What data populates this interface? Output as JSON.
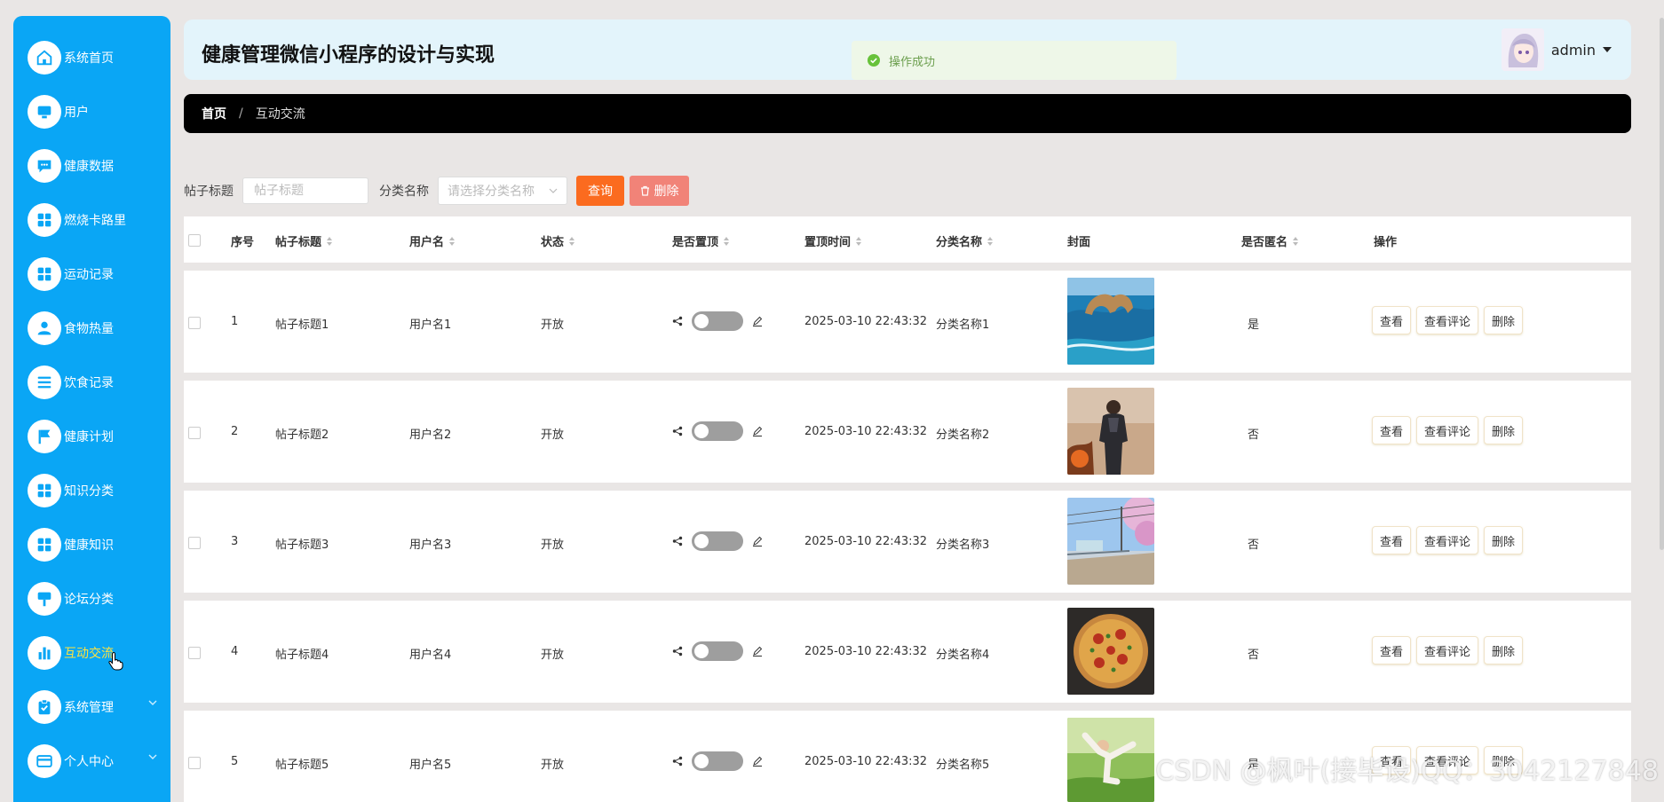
{
  "app_title": "健康管理微信小程序的设计与实现",
  "toast": "操作成功",
  "user": {
    "name": "admin"
  },
  "breadcrumb": {
    "home": "首页",
    "separator": "/",
    "current": "互动交流"
  },
  "sidebar": {
    "items": [
      {
        "label": "系统首页",
        "icon": "home-icon"
      },
      {
        "label": "用户",
        "icon": "monitor-icon"
      },
      {
        "label": "健康数据",
        "icon": "chat-icon"
      },
      {
        "label": "燃烧卡路里",
        "icon": "grid-icon"
      },
      {
        "label": "运动记录",
        "icon": "grid-icon"
      },
      {
        "label": "食物热量",
        "icon": "user-icon"
      },
      {
        "label": "饮食记录",
        "icon": "list-icon"
      },
      {
        "label": "健康计划",
        "icon": "flag-icon"
      },
      {
        "label": "知识分类",
        "icon": "grid-icon"
      },
      {
        "label": "健康知识",
        "icon": "grid-icon"
      },
      {
        "label": "论坛分类",
        "icon": "signpost-icon"
      },
      {
        "label": "互动交流",
        "icon": "bar-chart-icon",
        "active": true
      },
      {
        "label": "系统管理",
        "icon": "clipboard-icon",
        "expandable": true
      },
      {
        "label": "个人中心",
        "icon": "card-icon",
        "expandable": true
      }
    ]
  },
  "search": {
    "title_label": "帖子标题",
    "title_placeholder": "帖子标题",
    "category_label": "分类名称",
    "category_placeholder": "请选择分类名称",
    "query_button": "查询",
    "delete_button": "删除"
  },
  "table": {
    "headers": {
      "index": "序号",
      "title": "帖子标题",
      "username": "用户名",
      "status": "状态",
      "pinned": "是否置顶",
      "pin_time": "置顶时间",
      "category": "分类名称",
      "cover": "封面",
      "anonymous": "是否匿名",
      "actions": "操作"
    },
    "rows": [
      {
        "index": "1",
        "title": "帖子标题1",
        "username": "用户名1",
        "status": "开放",
        "pinned": false,
        "pin_time": "2025-03-10 22:43:32",
        "category": "分类名称1",
        "cover": "sea-arch-photo",
        "anonymous": "是"
      },
      {
        "index": "2",
        "title": "帖子标题2",
        "username": "用户名2",
        "status": "开放",
        "pinned": false,
        "pin_time": "2025-03-10 22:43:32",
        "category": "分类名称2",
        "cover": "hero-figure-photo",
        "anonymous": "否"
      },
      {
        "index": "3",
        "title": "帖子标题3",
        "username": "用户名3",
        "status": "开放",
        "pinned": false,
        "pin_time": "2025-03-10 22:43:32",
        "category": "分类名称3",
        "cover": "anime-street-photo",
        "anonymous": "否"
      },
      {
        "index": "4",
        "title": "帖子标题4",
        "username": "用户名4",
        "status": "开放",
        "pinned": false,
        "pin_time": "2025-03-10 22:43:32",
        "category": "分类名称4",
        "cover": "pizza-photo",
        "anonymous": "否"
      },
      {
        "index": "5",
        "title": "帖子标题5",
        "username": "用户名5",
        "status": "开放",
        "pinned": false,
        "pin_time": "2025-03-10 22:43:32",
        "category": "分类名称5",
        "cover": "yoga-photo",
        "anonymous": "是"
      }
    ],
    "row_actions": {
      "view": "查看",
      "view_comments": "查看评论",
      "delete": "删除"
    }
  },
  "watermark": "CSDN @枫叶(接毕设)QQ：3042127848",
  "colors": {
    "sidebar": "#0aa6f5",
    "header": "#e3f4fb",
    "breadcrumb": "#000000",
    "query_button": "#fb6b1f",
    "delete_button": "#f18378",
    "active_menu": "#ffe23f"
  }
}
